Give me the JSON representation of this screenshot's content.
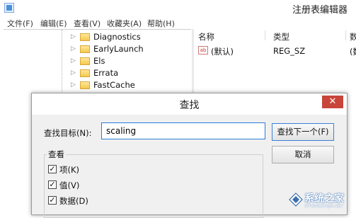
{
  "window": {
    "title": "注册表编辑器"
  },
  "menu": [
    {
      "label": "文件(F)"
    },
    {
      "label": "编辑(E)"
    },
    {
      "label": "查看(V)"
    },
    {
      "label": "收藏夹(A)"
    },
    {
      "label": "帮助(H)"
    }
  ],
  "tree": {
    "items": [
      {
        "label": "Diagnostics"
      },
      {
        "label": "EarlyLaunch"
      },
      {
        "label": "Els"
      },
      {
        "label": "Errata"
      },
      {
        "label": "FastCache"
      }
    ]
  },
  "list": {
    "columns": [
      {
        "label": "名称"
      },
      {
        "label": "类型"
      },
      {
        "label": "数"
      }
    ],
    "rows": [
      {
        "name": "(默认)",
        "type": "REG_SZ",
        "data": "(数"
      }
    ]
  },
  "dialog": {
    "title": "查找",
    "close_glyph": "✕",
    "find_label": "查找目标(N):",
    "find_value": "scaling",
    "find_next_label": "查找下一个(F)",
    "cancel_label": "取消",
    "look_at_label": "查看",
    "options": [
      {
        "label": "项(K)",
        "checked": true
      },
      {
        "label": "值(V)",
        "checked": true
      },
      {
        "label": "数据(D)",
        "checked": true
      }
    ]
  },
  "watermark": {
    "text": "系统之家",
    "sub": "XITONGZHIJIA.NET"
  }
}
